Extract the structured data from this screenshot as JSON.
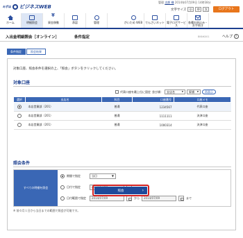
{
  "header": {
    "logo_small": "みずほ",
    "logo_text": "ビジネスWEB",
    "user_prefix": "管理",
    "user_name": "太郎 様",
    "last_login": "2014年07月09日 14時38分",
    "font_size_label": "文字サイズ",
    "font_small": "小",
    "font_medium": "中",
    "font_large": "大",
    "logout": "ログアウト"
  },
  "nav": {
    "left": [
      {
        "label": "ホーム",
        "icon": "home-icon"
      },
      {
        "label": "明細照会",
        "icon": "statement-icon",
        "active": true
      },
      {
        "label": "資金移動",
        "icon": "transfer-icon"
      },
      {
        "label": "承認",
        "icon": "approval-icon"
      },
      {
        "label": "管理",
        "icon": "management-icon"
      }
    ],
    "right": [
      {
        "label": "がいため WEB",
        "icon": "forex-icon"
      },
      {
        "label": "でんさいネット",
        "icon": "densai-icon"
      },
      {
        "label": "電子ロボサービス",
        "icon": "robo-icon"
      },
      {
        "label": "各種お申込み・お手続き",
        "icon": "application-icon"
      }
    ]
  },
  "title": {
    "main": "入出金明細照会［オンライン］",
    "sub": "条件指定",
    "screen_id": "BNNK001",
    "help": "ヘルプ"
  },
  "steps": [
    "条件指定",
    "照会結果"
  ],
  "instruction": "対象口座、照会条件を選択の上、「照会」ボタンをクリックしてください。",
  "accounts": {
    "section_title": "対象口座",
    "representative_first": "代表口座を最上位に固定",
    "sort_label": "並び順：",
    "sort_value": "支店名",
    "order_value": "昇順",
    "resort": "再表示",
    "columns": [
      "選択",
      "支店名",
      "科目",
      "口座番号",
      "口座メモ"
    ],
    "rows": [
      {
        "branch": "本店営業部（201）",
        "type": "普通",
        "number": "1234567",
        "memo": "代表口座",
        "selected": true
      },
      {
        "branch": "本店営業部（201）",
        "type": "普通",
        "number": "1111111",
        "memo": "決済口座",
        "selected": false
      },
      {
        "branch": "本店営業部（201）",
        "type": "普通",
        "number": "1000314",
        "memo": "決済口座",
        "selected": false
      }
    ]
  },
  "conditions": {
    "section_title": "照会条件",
    "label": "すべての明細を照会",
    "period_label": "期間で指定",
    "period_value": "当日",
    "date_label": "日付で指定",
    "date_value": "2014/07/09",
    "range_label": "日付範囲で指定",
    "range_from": "2014/07/09",
    "range_sep": "から",
    "range_to": "2014/07/09",
    "range_end": "まで"
  },
  "note": "※ 前々月１日から当日までの範囲で照会が可能です。",
  "submit": "照会"
}
